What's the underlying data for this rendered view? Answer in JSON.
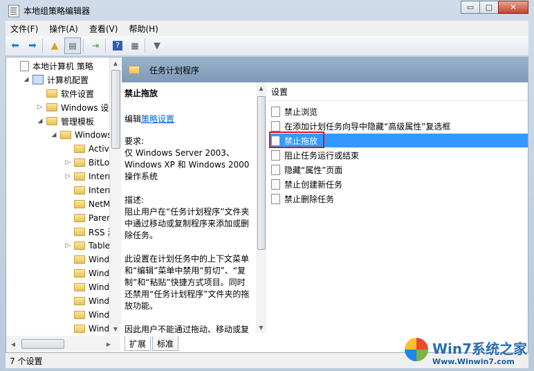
{
  "window": {
    "title": "本地组策略编辑器",
    "minimize_glyph": "▭",
    "maximize_glyph": "□",
    "close_glyph": "✕"
  },
  "menu": [
    "文件(F)",
    "操作(A)",
    "查看(V)",
    "帮助(H)"
  ],
  "tree": {
    "items": [
      {
        "label": "本地计算机 策略",
        "icon": "policy-icon",
        "level": 0,
        "expander": ""
      },
      {
        "label": "计算机配置",
        "icon": "computer-icon",
        "level": 1,
        "expander": "◢"
      },
      {
        "label": "软件设置",
        "icon": "folder-icon",
        "level": 2,
        "expander": ""
      },
      {
        "label": "Windows 设置",
        "icon": "folder-icon",
        "level": 2,
        "expander": "▷"
      },
      {
        "label": "管理模板",
        "icon": "folder-icon",
        "level": 2,
        "expander": "◢"
      },
      {
        "label": "Windows",
        "icon": "folder-icon",
        "level": 3,
        "expander": "◢"
      },
      {
        "label": "Active",
        "icon": "folder-icon",
        "level": 4,
        "expander": ""
      },
      {
        "label": "BitLoc",
        "icon": "folder-icon",
        "level": 4,
        "expander": "▷"
      },
      {
        "label": "Intern",
        "icon": "folder-icon",
        "level": 4,
        "expander": "▷"
      },
      {
        "label": "Intern",
        "icon": "folder-icon",
        "level": 4,
        "expander": ""
      },
      {
        "label": "NetMe",
        "icon": "folder-icon",
        "level": 4,
        "expander": ""
      },
      {
        "label": "Parent",
        "icon": "folder-icon",
        "level": 4,
        "expander": ""
      },
      {
        "label": "RSS 源",
        "icon": "folder-icon",
        "level": 4,
        "expander": ""
      },
      {
        "label": "Tablet",
        "icon": "folder-icon",
        "level": 4,
        "expander": "▷"
      },
      {
        "label": "Windo",
        "icon": "folder-icon",
        "level": 4,
        "expander": ""
      },
      {
        "label": "Windo",
        "icon": "folder-icon",
        "level": 4,
        "expander": ""
      },
      {
        "label": "Windo",
        "icon": "folder-icon",
        "level": 4,
        "expander": ""
      },
      {
        "label": "Windo",
        "icon": "folder-icon",
        "level": 4,
        "expander": ""
      },
      {
        "label": "Windo",
        "icon": "folder-icon",
        "level": 4,
        "expander": ""
      },
      {
        "label": "Windo",
        "icon": "folder-icon",
        "level": 4,
        "expander": ""
      }
    ]
  },
  "header": {
    "title": "任务计划程序"
  },
  "description": {
    "title": "禁止拖放",
    "edit_prefix": "编辑",
    "edit_link": "策略设置",
    "requirement_label": "要求:",
    "requirement_text": "仅 Windows Server 2003、Windows XP 和 Windows 2000 操作系统",
    "description_label": "描述:",
    "description_text": "阻止用户在“任务计划程序”文件夹中通过移动或复制程序来添加或删除任务。",
    "description_text2": "此设置在计划任务中的上下文菜单和“编辑”菜单中禁用“剪切”、“复制”和“粘贴”快捷方式项目。同时还禁用“任务计划程序”文件夹的拖放功能。",
    "description_text3": "因此用户不能通过拖动、移动或复"
  },
  "list": {
    "column_header": "设置",
    "items": [
      {
        "label": "禁止浏览",
        "selected": false
      },
      {
        "label": "在添加计划任务向导中隐藏“高级属性”复选框",
        "selected": false
      },
      {
        "label": "禁止拖放",
        "selected": true
      },
      {
        "label": "阻止任务运行或结束",
        "selected": false
      },
      {
        "label": "隐藏“属性”页面",
        "selected": false
      },
      {
        "label": "禁止创建新任务",
        "selected": false
      },
      {
        "label": "禁止删除任务",
        "selected": false
      }
    ]
  },
  "tabs": [
    "扩展",
    "标准"
  ],
  "status": {
    "text": "7 个设置"
  },
  "watermark": {
    "title": "Win7系统之家",
    "url": "Www.Winwin7.com"
  },
  "colors": {
    "selection": "#3399ff",
    "highlight_box": "#e0101a",
    "header_band": "#8aa6c2",
    "link": "#0066cc"
  }
}
